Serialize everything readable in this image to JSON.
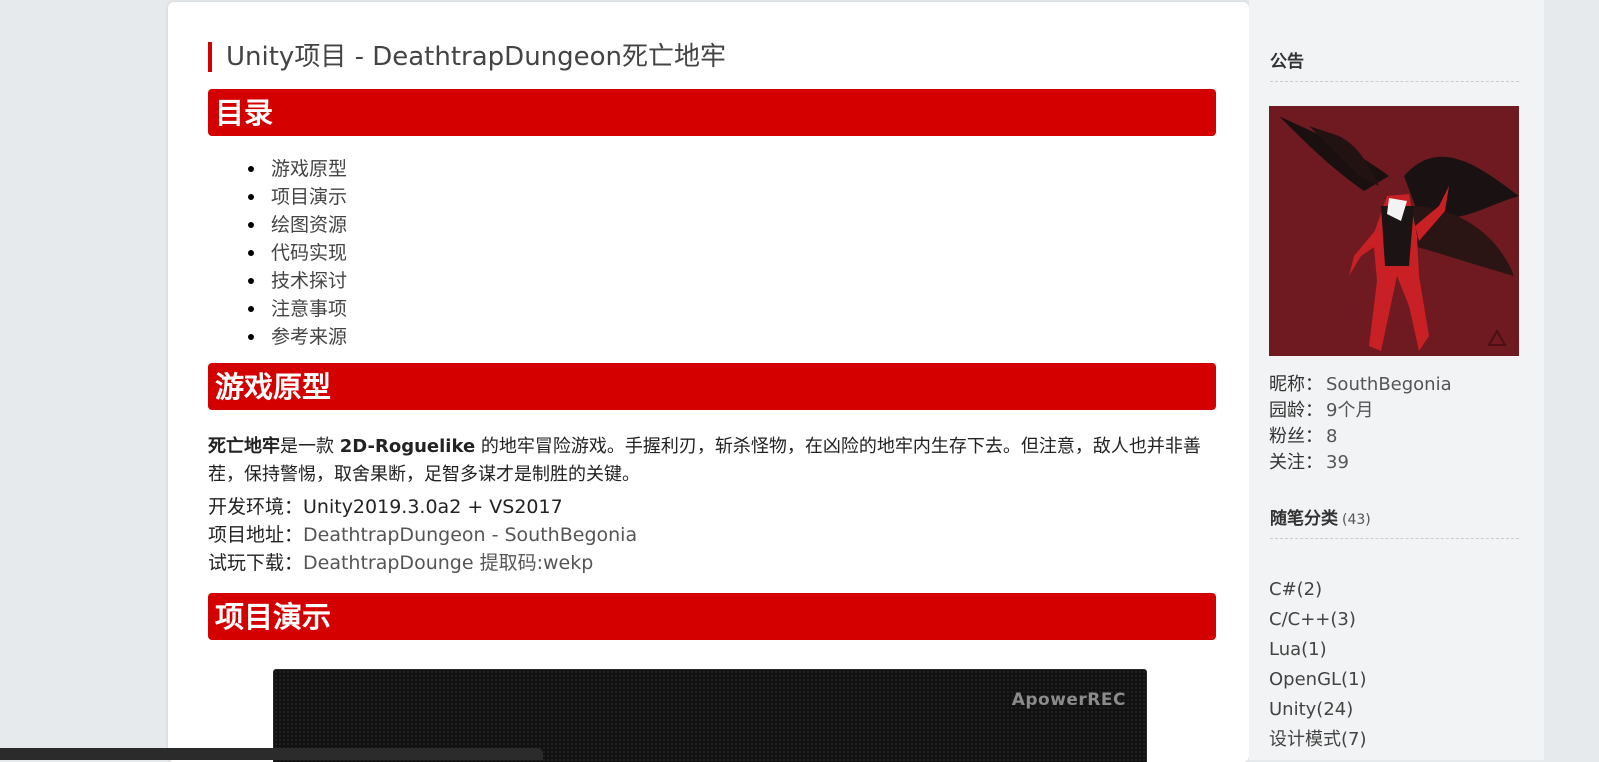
{
  "post": {
    "title": "Unity项目 - DeathtrapDungeon死亡地牢"
  },
  "sections": {
    "toc": "目录",
    "prototype": "游戏原型",
    "demo": "项目演示"
  },
  "toc_items": [
    "游戏原型",
    "项目演示",
    "绘图资源",
    "代码实现",
    "技术探讨",
    "注意事项",
    "参考来源"
  ],
  "intro": {
    "name": "死亡地牢",
    "text1": "是一款 ",
    "genre": "2D-Roguelike",
    "text2": " 的地牢冒险游戏。手握利刃，斩杀怪物，在凶险的地牢内生存下去。但注意，敌人也并非善茬，保持警惕，取舍果断，足智多谋才是制胜的关键。"
  },
  "info": {
    "env_label": "开发环境：",
    "env_value": "Unity2019.3.0a2 + VS2017",
    "repo_label": "项目地址：",
    "repo_link": "DeathtrapDungeon - SouthBegonia",
    "download_label": "试玩下载：",
    "download_link": "DeathtrapDounge 提取码:wekp"
  },
  "video": {
    "watermark": "ApowerREC"
  },
  "sidebar": {
    "notice_title": "公告",
    "profile": [
      {
        "label": "昵称：",
        "value": "SouthBegonia"
      },
      {
        "label": "园龄：",
        "value": "9个月"
      },
      {
        "label": "粉丝：",
        "value": "8"
      },
      {
        "label": "关注：",
        "value": "39"
      }
    ],
    "categories_title": "随笔分类",
    "categories_count": "(43)",
    "categories": [
      "C#(2)",
      "C/C++(3)",
      "Lua(1)",
      "OpenGL(1)",
      "Unity(24)",
      "设计模式(7)"
    ]
  },
  "colors": {
    "accent": "#d40000",
    "avatar_bg": "#6e1a20"
  }
}
